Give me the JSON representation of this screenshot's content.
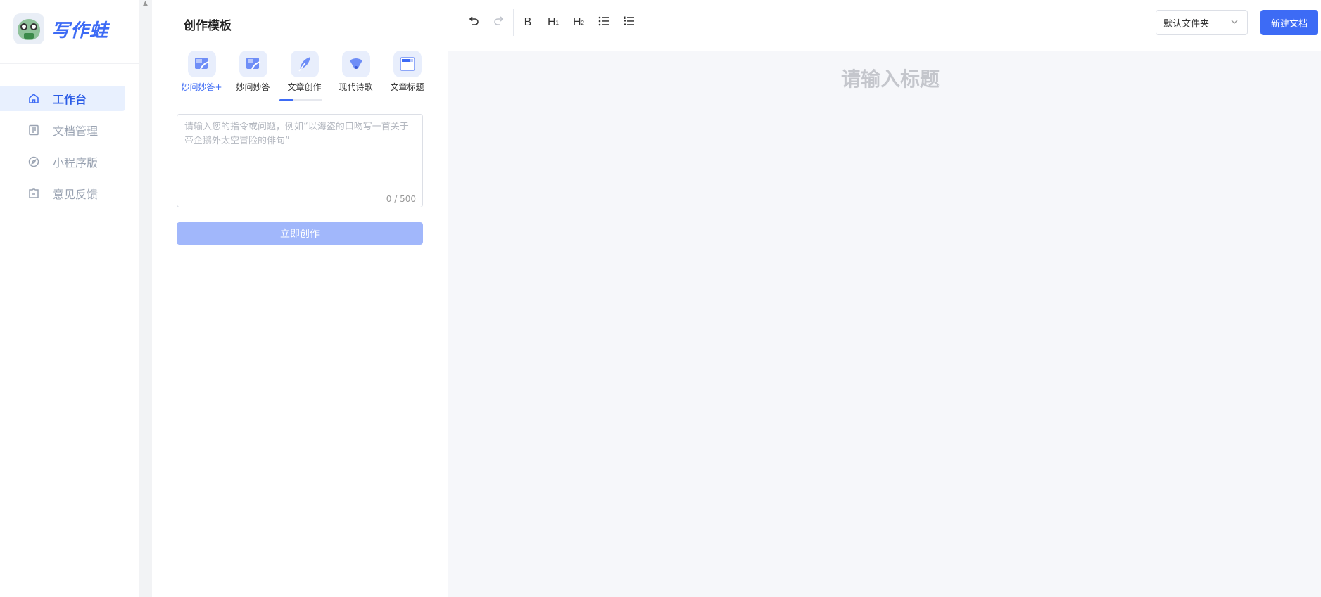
{
  "brand": {
    "name": "写作蛙"
  },
  "sidebar": {
    "items": [
      {
        "label": "工作台",
        "icon": "home-icon",
        "active": true
      },
      {
        "label": "文档管理",
        "icon": "document-icon",
        "active": false
      },
      {
        "label": "小程序版",
        "icon": "compass-icon",
        "active": false
      },
      {
        "label": "意见反馈",
        "icon": "feedback-icon",
        "active": false
      }
    ]
  },
  "panel": {
    "title": "创作模板",
    "templates": [
      {
        "label": "妙问妙答+",
        "icon": "image-edit-icon",
        "active": true
      },
      {
        "label": "妙问妙答",
        "icon": "image-edit-icon",
        "active": false
      },
      {
        "label": "文章创作",
        "icon": "feather-icon",
        "active": false
      },
      {
        "label": "现代诗歌",
        "icon": "fan-icon",
        "active": false
      },
      {
        "label": "文章标题",
        "icon": "window-icon",
        "active": false
      }
    ],
    "prompt": {
      "placeholder": "请输入您的指令或问题，例如“以海盗的口吻写一首关于帝企鹅外太空冒险的俳句”",
      "value": "",
      "count": "0 / 500"
    },
    "create_button": "立即创作"
  },
  "toolbar": {
    "undo": "undo-icon",
    "redo": "redo-icon",
    "bold": "B",
    "h1": "H",
    "h1_sub": "1",
    "h2": "H",
    "h2_sub": "2",
    "bullet_list": "bullet-list-icon",
    "ordered_list": "ordered-list-icon"
  },
  "header": {
    "folder_select": "默认文件夹",
    "new_doc_button": "新建文档"
  },
  "editor": {
    "title_placeholder": "请输入标题"
  },
  "colors": {
    "accent": "#3d6bf5",
    "accent_light": "#a1b7fb",
    "nav_active_bg": "#e8f0fe",
    "editor_bg": "#f6f7fa"
  }
}
